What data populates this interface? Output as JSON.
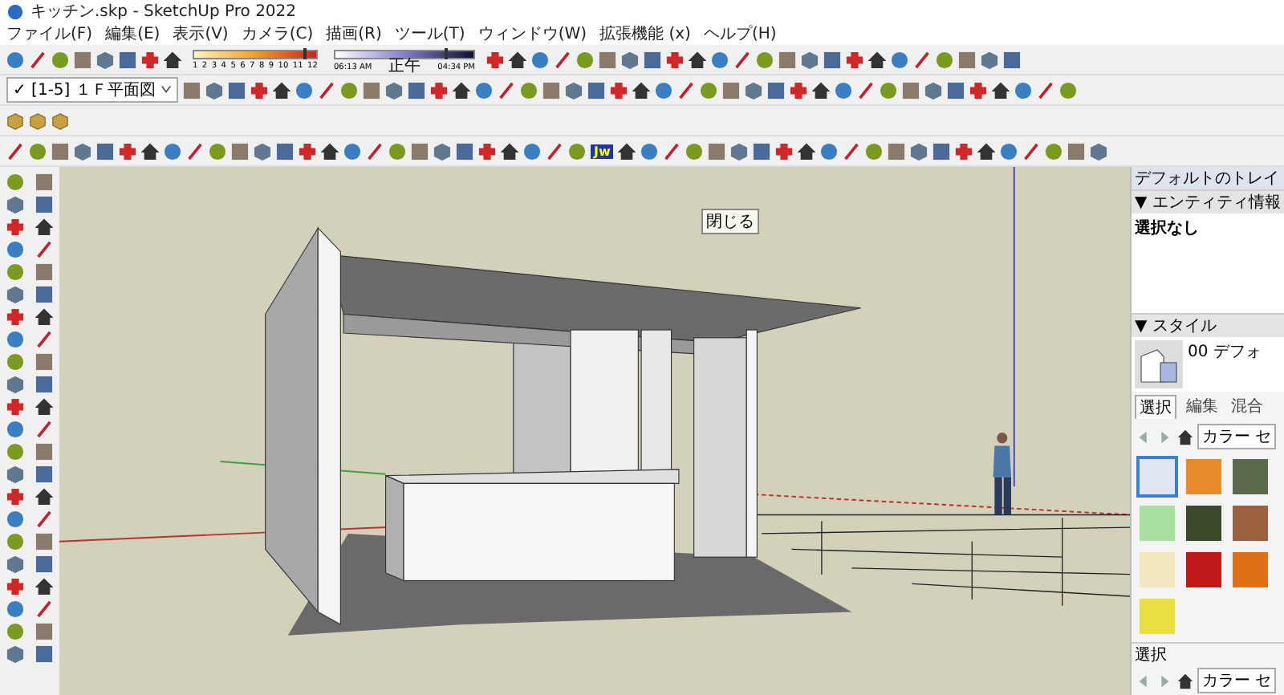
{
  "window": {
    "title": "キッチン.skp - SketchUp Pro 2022"
  },
  "menu": [
    "ファイル(F)",
    "編集(E)",
    "表示(V)",
    "カメラ(C)",
    "描画(R)",
    "ツール(T)",
    "ウィンドウ(W)",
    "拡張機能 (x)",
    "ヘルプ(H)"
  ],
  "shadow": {
    "months": [
      "1",
      "2",
      "3",
      "4",
      "5",
      "6",
      "7",
      "8",
      "9",
      "10",
      "11",
      "12"
    ],
    "month_slider": {
      "level": 0.88
    },
    "time_start": "06:13 AM",
    "time_mid": "正午",
    "time_end": "04:34 PM",
    "time_slider": {
      "level": 0.78
    }
  },
  "scene_dropdown": {
    "check": "✓",
    "value": "[1-5] １Ｆ平面図"
  },
  "jw_badge": "Jw",
  "tooltip": "閉じる",
  "tray": {
    "title": "デフォルトのトレイ",
    "entity_header": "▼ エンティティ情報",
    "entity_value": "選択なし",
    "style_header": "▼ スタイル",
    "style_name": "00 デフォ",
    "tabs": [
      {
        "label": "選択",
        "selected": true
      },
      {
        "label": "編集",
        "selected": false
      },
      {
        "label": "混合",
        "selected": false
      }
    ],
    "collection": "カラー セ",
    "swatches": [
      {
        "color": "#dfe6f2",
        "selected": true
      },
      {
        "color": "#e88a2c",
        "selected": false
      },
      {
        "color": "#5a6a4a",
        "selected": false
      },
      {
        "color": "#a8e0a0",
        "selected": false
      },
      {
        "color": "#3a4a2a",
        "selected": false
      },
      {
        "color": "#9a6040",
        "selected": false
      },
      {
        "color": "#f4e8c0",
        "selected": false
      },
      {
        "color": "#c01818",
        "selected": false
      },
      {
        "color": "#e07018",
        "selected": false
      },
      {
        "color": "#e8e040",
        "selected": false
      }
    ],
    "bottom_header": "選択",
    "bottom_collection": "カラー セ"
  }
}
